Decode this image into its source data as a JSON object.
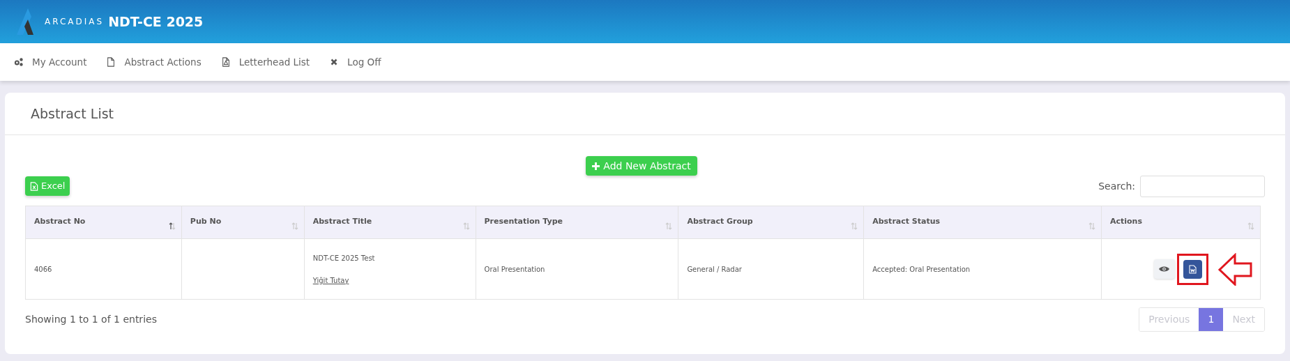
{
  "header": {
    "logo_text": "ARCADIAS",
    "title": "NDT-CE 2025"
  },
  "nav": [
    {
      "kind": "gears",
      "label": "My Account"
    },
    {
      "kind": "file",
      "label": "Abstract Actions"
    },
    {
      "kind": "pdf",
      "label": "Letterhead List"
    },
    {
      "kind": "close",
      "label": "Log Off"
    }
  ],
  "card": {
    "title": "Abstract List",
    "add_button": "Add New Abstract",
    "excel_button": "Excel",
    "search_label": "Search:"
  },
  "table": {
    "columns": [
      {
        "label": "Abstract No",
        "sorted": true
      },
      {
        "label": "Pub No",
        "sorted": false
      },
      {
        "label": "Abstract Title",
        "sorted": false
      },
      {
        "label": "Presentation Type",
        "sorted": false
      },
      {
        "label": "Abstract Group",
        "sorted": false
      },
      {
        "label": "Abstract Status",
        "sorted": false
      },
      {
        "label": "Actions",
        "sorted": false
      }
    ],
    "rows": [
      {
        "abstract_no": "4066",
        "pub_no": "",
        "title": "NDT-CE 2025 Test",
        "author": "Yiğit Tutay",
        "presentation_type": "Oral Presentation",
        "group": "General / Radar",
        "status": "Accepted: Oral Presentation"
      }
    ]
  },
  "footer": {
    "info": "Showing 1 to 1 of 1 entries",
    "pagination": [
      {
        "label": "Previous",
        "kind": "nav",
        "disabled": true
      },
      {
        "label": "1",
        "kind": "page",
        "selected": true
      },
      {
        "label": "Next",
        "kind": "nav",
        "disabled": true
      }
    ]
  }
}
